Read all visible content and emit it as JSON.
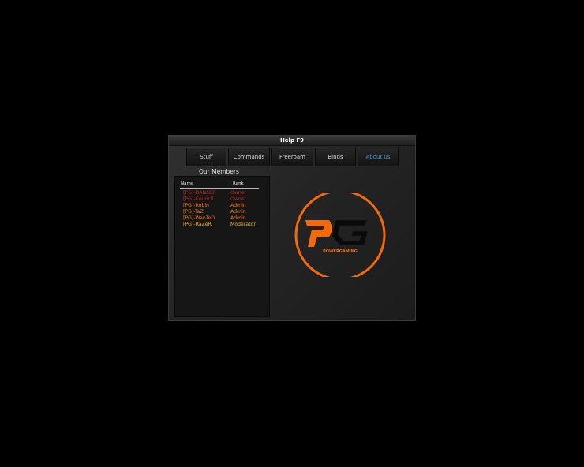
{
  "window": {
    "title": "Help F9"
  },
  "tabs": [
    {
      "label": "Stuff",
      "active": false
    },
    {
      "label": "Commands",
      "active": false
    },
    {
      "label": "Freeroam",
      "active": false
    },
    {
      "label": "Binds",
      "active": false
    },
    {
      "label": "About us",
      "active": true
    }
  ],
  "members": {
    "title": "Our Members",
    "columns": {
      "name": "Name",
      "rank": "Rank"
    },
    "rows": [
      {
        "name": "[PG]-DANGER",
        "rank": "Owner",
        "color": "#c0251c"
      },
      {
        "name": "[PG]-Council",
        "rank": "Owner",
        "color": "#c0251c"
      },
      {
        "name": "[PG]-Robin",
        "rank": "Admin",
        "color": "#f07818"
      },
      {
        "name": "[PG]-TaZ",
        "rank": "Admin",
        "color": "#f07818"
      },
      {
        "name": "[PG]-WanTeD",
        "rank": "Admin",
        "color": "#f07818"
      },
      {
        "name": "[PG]-RaZeR",
        "rank": "Moderator",
        "color": "#e8b61e"
      }
    ]
  },
  "logo": {
    "text": "POWERGAMING",
    "accent": "#f26a10"
  }
}
